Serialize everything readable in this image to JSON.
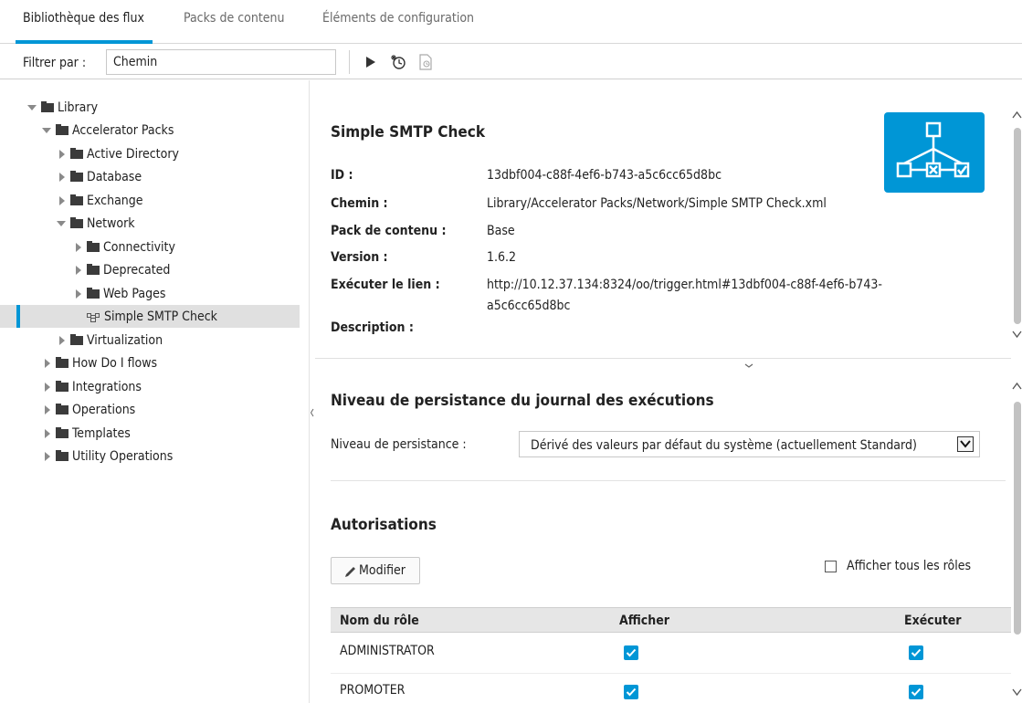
{
  "tabs": [
    {
      "label": "Bibliothèque des flux"
    },
    {
      "label": "Packs de contenu"
    },
    {
      "label": "Éléments de configuration"
    }
  ],
  "toolbar": {
    "filter_label": "Filtrer par :",
    "filter_value": "Chemin"
  },
  "tree": {
    "items": [
      {
        "label": "Library"
      },
      {
        "label": "Accelerator Packs"
      },
      {
        "label": "Active Directory"
      },
      {
        "label": "Database"
      },
      {
        "label": "Exchange"
      },
      {
        "label": "Network"
      },
      {
        "label": "Connectivity"
      },
      {
        "label": "Deprecated"
      },
      {
        "label": "Web Pages"
      },
      {
        "label": "Simple SMTP Check"
      },
      {
        "label": "Virtualization"
      },
      {
        "label": "How Do I flows"
      },
      {
        "label": "Integrations"
      },
      {
        "label": "Operations"
      },
      {
        "label": "Templates"
      },
      {
        "label": "Utility Operations"
      }
    ]
  },
  "detail": {
    "title": "Simple SMTP Check",
    "props": [
      {
        "label": "ID :",
        "value": "13dbf004-c88f-4ef6-b743-a5c6cc65d8bc"
      },
      {
        "label": "Chemin :",
        "value": "Library/Accelerator Packs/Network/Simple SMTP Check.xml"
      },
      {
        "label": "Pack de contenu :",
        "value": "Base"
      },
      {
        "label": "Version :",
        "value": "1.6.2"
      },
      {
        "label": "Exécuter le lien :",
        "value_line1": "http://10.12.37.134:8324/oo/trigger.html#13dbf004-c88f-4ef6-b743-",
        "value_line2": "a5c6cc65d8bc"
      },
      {
        "label": "Description :",
        "value": ""
      }
    ]
  },
  "persistence": {
    "title": "Niveau de persistance du journal des exécutions",
    "label": "Niveau de persistance :",
    "selected": "Dérivé des valeurs par défaut du système (actuellement Standard)"
  },
  "permissions": {
    "title": "Autorisations",
    "modify_label": "Modifier",
    "show_all_label": "Afficher tous les rôles",
    "columns": [
      "Nom du rôle",
      "Afficher",
      "Exécuter"
    ],
    "rows": [
      {
        "name": "ADMINISTRATOR",
        "view": true,
        "execute": true
      },
      {
        "name": "PROMOTER",
        "view": true,
        "execute": true
      }
    ]
  },
  "colors": {
    "accent": "#0096d6",
    "selected_row": "#e0e0e0"
  }
}
